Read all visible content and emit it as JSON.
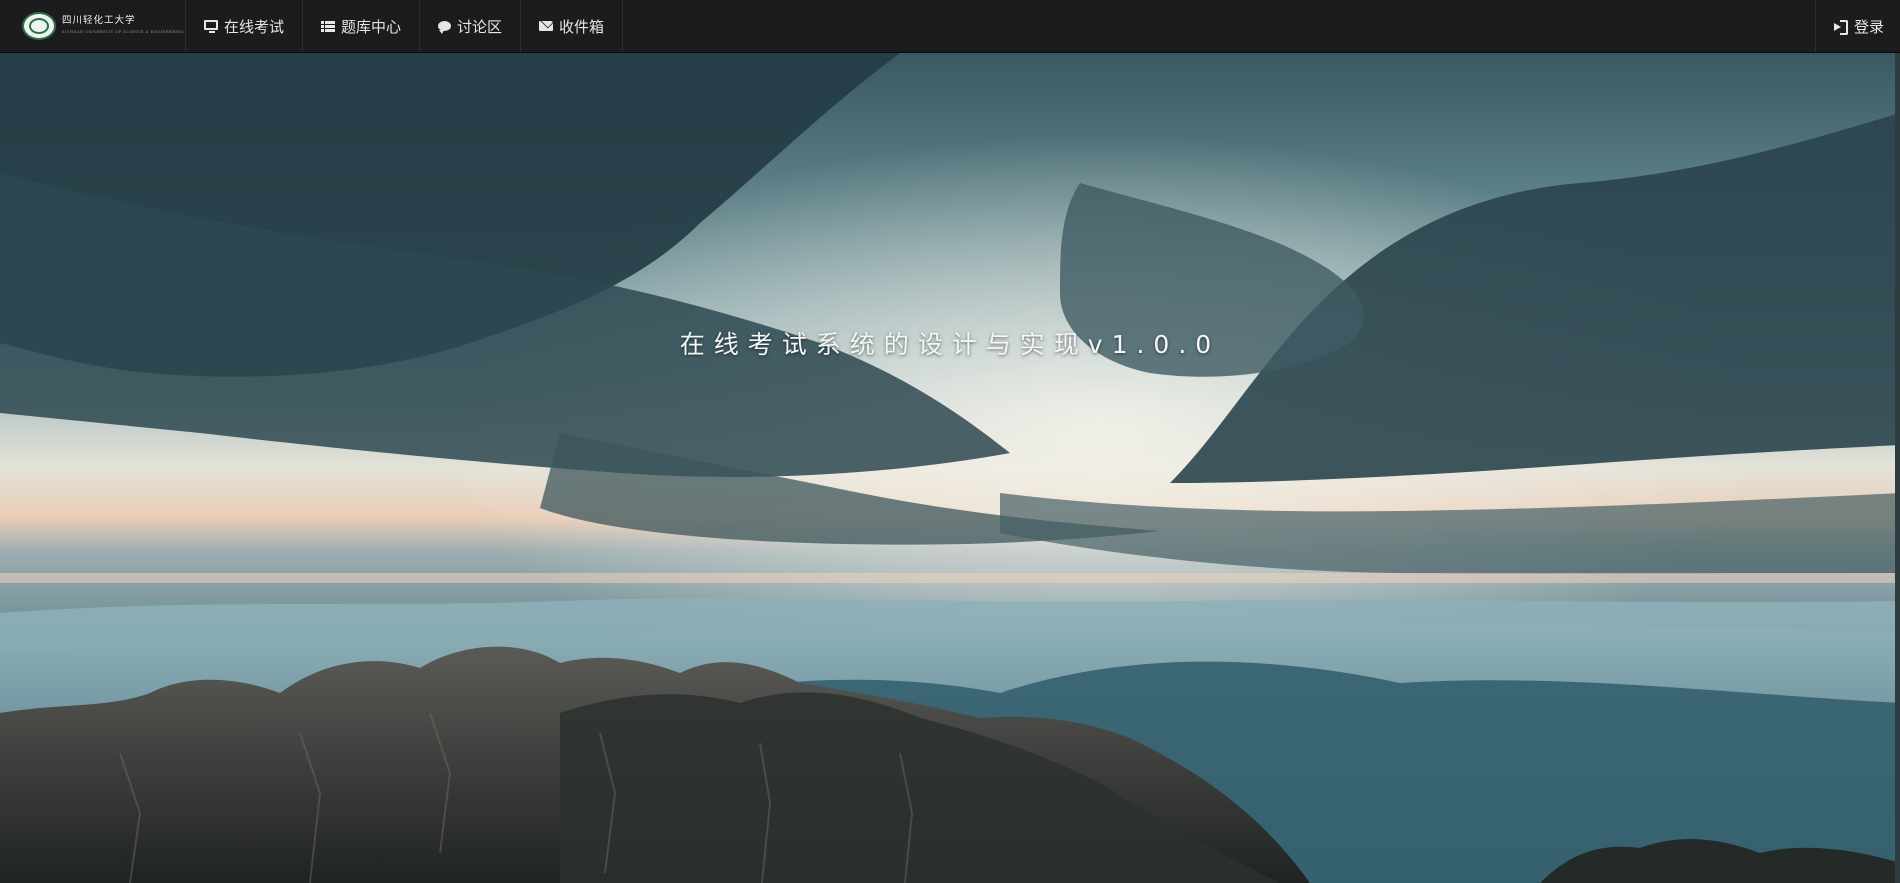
{
  "brand": {
    "logo_icon": "university-emblem",
    "name": "四川轻化工大学",
    "subtitle": "SICHUAN UNIVERSITY OF SCIENCE & ENGINEERING"
  },
  "nav": {
    "items": [
      {
        "label": "在线考试",
        "icon": "monitor-icon"
      },
      {
        "label": "题库中心",
        "icon": "list-icon"
      },
      {
        "label": "讨论区",
        "icon": "comment-icon"
      },
      {
        "label": "收件箱",
        "icon": "envelope-icon"
      }
    ],
    "login": {
      "label": "登录",
      "icon": "login-icon"
    }
  },
  "hero": {
    "title": "在线考试系统的设计与实现v1.0.0",
    "background": "sky-clouds-mountains-photo"
  },
  "colors": {
    "navbar_bg": "#1c1c1e",
    "nav_text": "#e6e6e6",
    "brand_green": "#2e6f4b",
    "title_text": "#f4f7f8"
  }
}
